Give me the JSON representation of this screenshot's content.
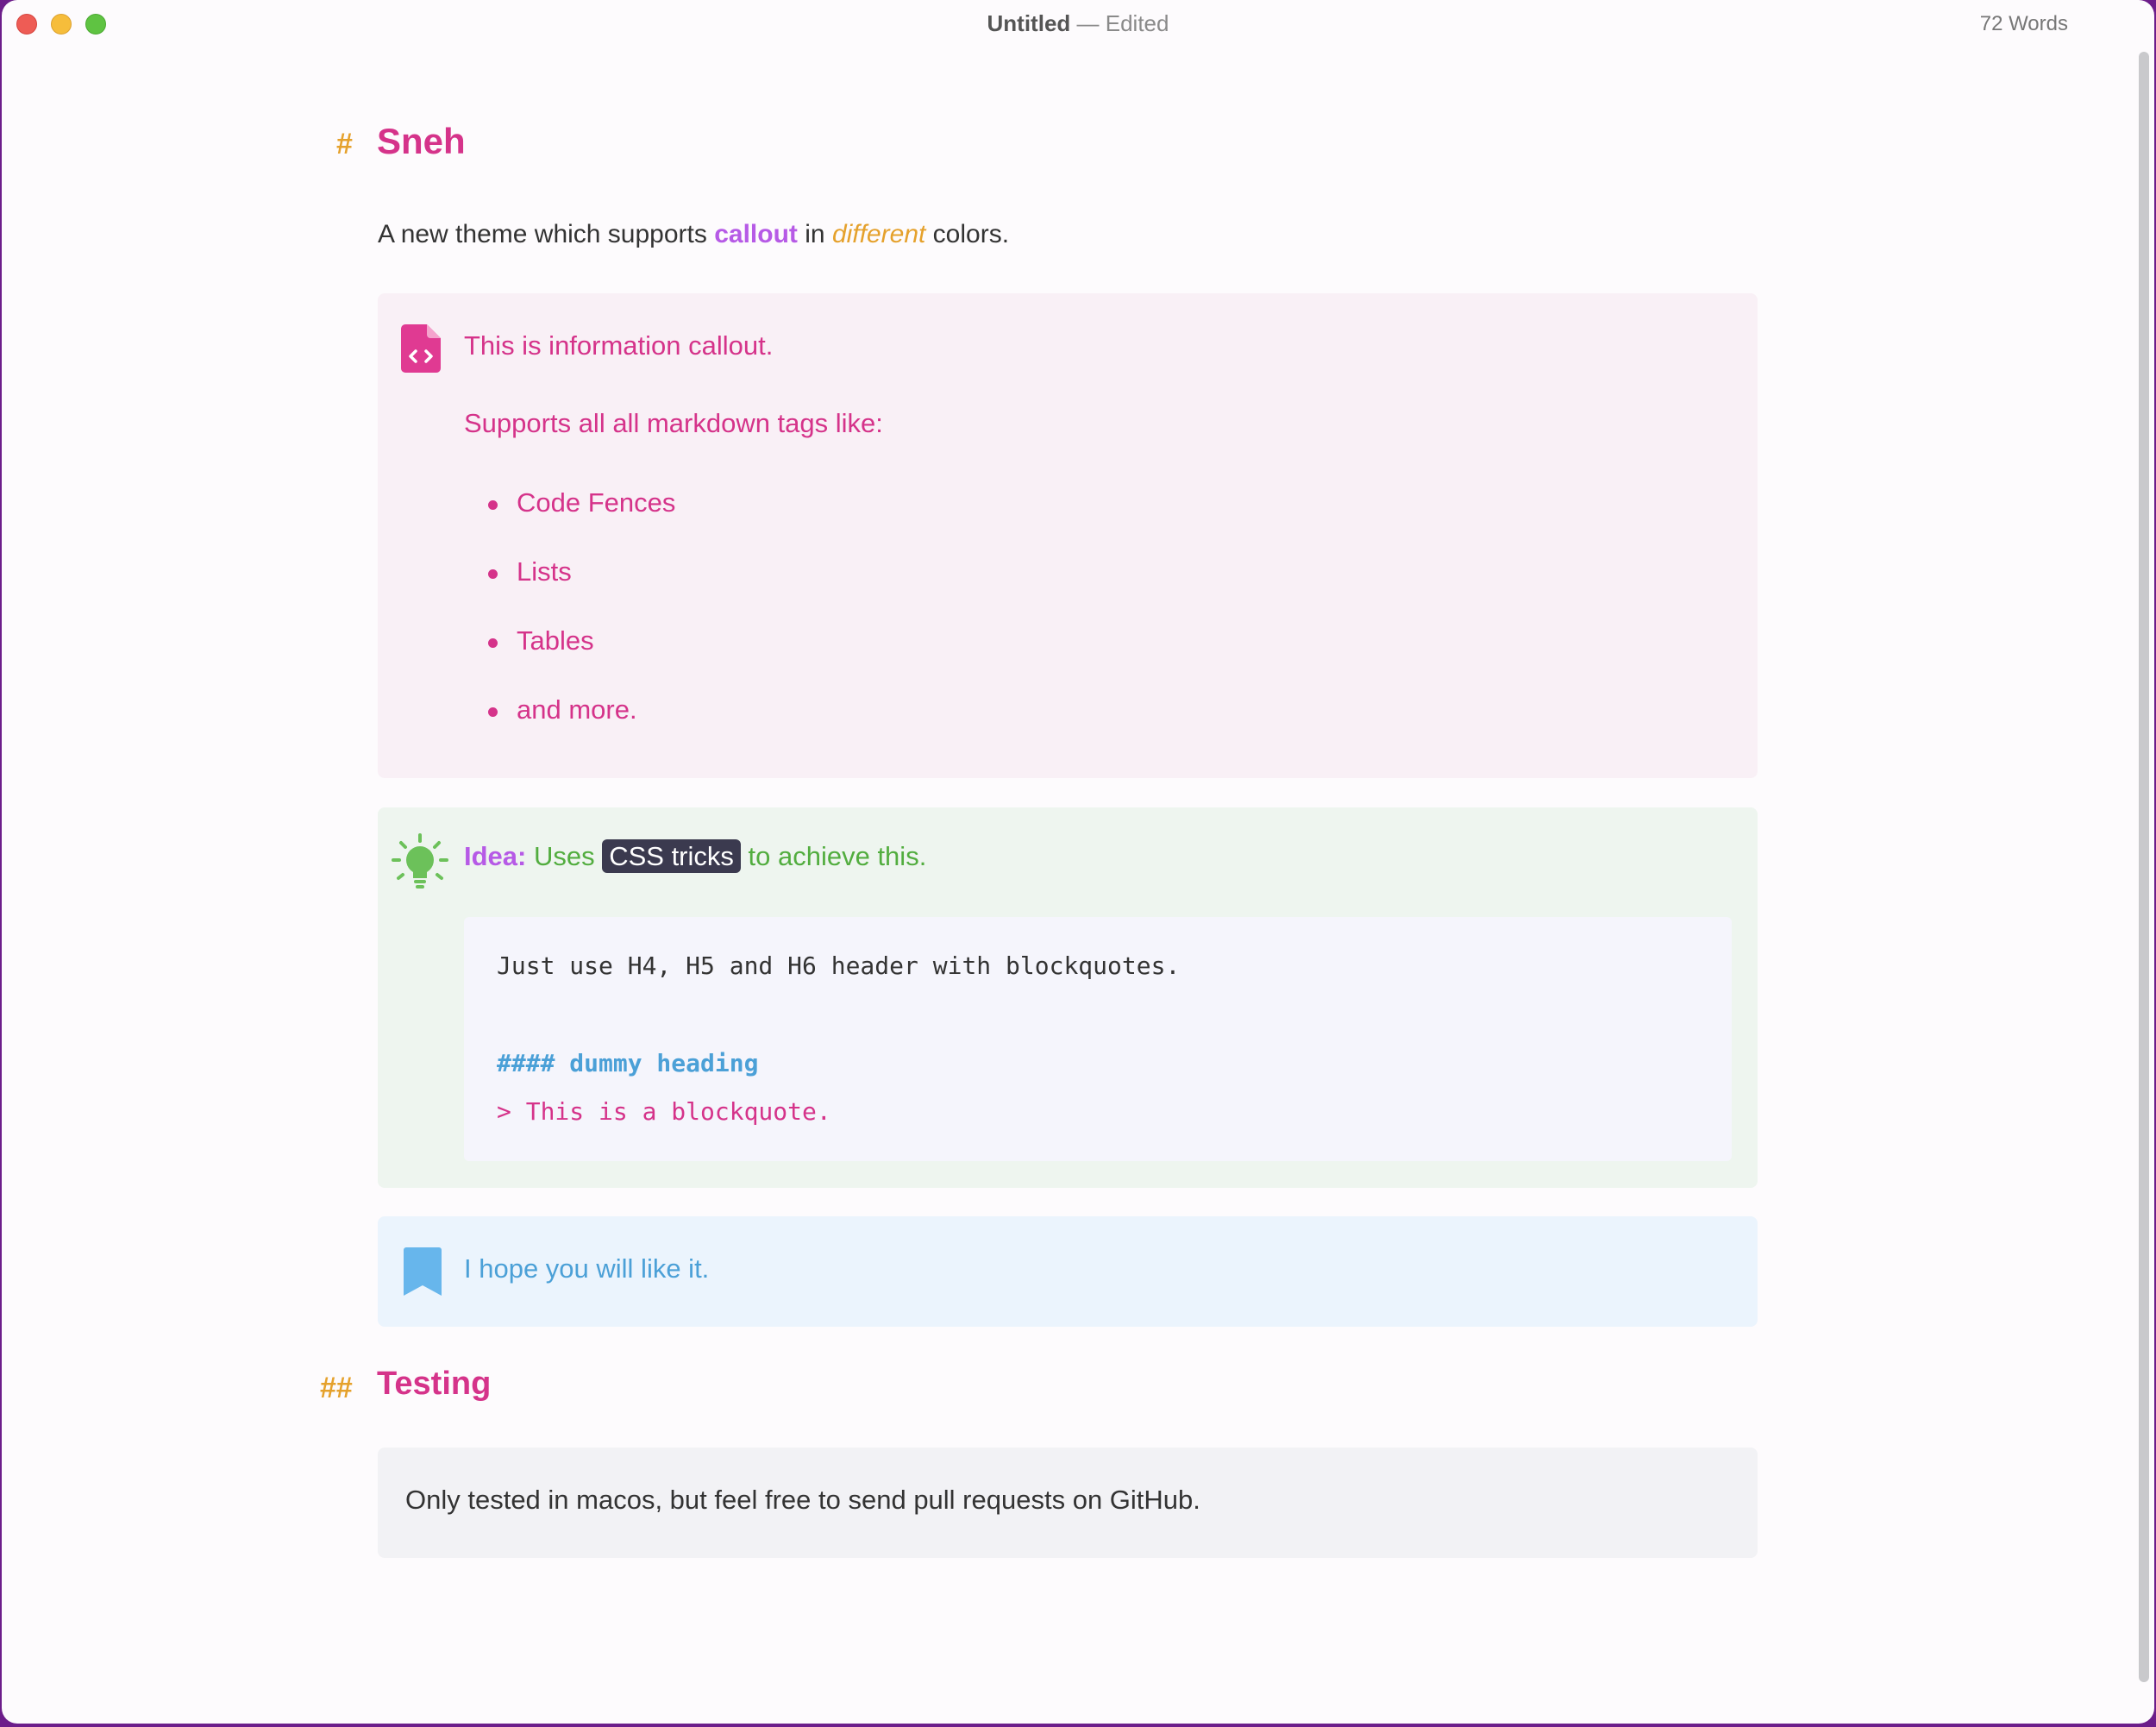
{
  "window": {
    "doc_title": "Untitled",
    "separator": "—",
    "status": "Edited",
    "word_count": "72 Words"
  },
  "doc": {
    "h1_marker": "#",
    "h1": "Sneh",
    "intro": {
      "before": "A new theme which supports ",
      "keyword": "callout",
      "middle": " in ",
      "emphasis": "different",
      "after": " colors."
    },
    "info_callout": {
      "icon": "file-code-icon",
      "line1": "This is information callout.",
      "line2": "Supports all all markdown tags like:",
      "items": [
        "Code Fences",
        "Lists",
        "Tables",
        "and more."
      ]
    },
    "idea_callout": {
      "icon": "lightbulb-icon",
      "label": "Idea:",
      "before": " Uses ",
      "code": "CSS tricks",
      "after": " to achieve this.",
      "code_lines": [
        "Just use H4, H5 and H6 header with blockquotes.",
        "#### dummy heading",
        "> This is a blockquote."
      ]
    },
    "note_callout": {
      "icon": "bookmark-icon",
      "text": "I hope you will like it."
    },
    "h2_marker": "##",
    "h2": "Testing",
    "plain_callout": {
      "text": "Only tested in macos, but feel free to send pull requests on GitHub."
    }
  },
  "colors": {
    "heading": "#d5338a",
    "marker": "#e5a12c",
    "keyword": "#b65ae6",
    "idea": "#52ad3f",
    "note": "#4ba0d7"
  }
}
